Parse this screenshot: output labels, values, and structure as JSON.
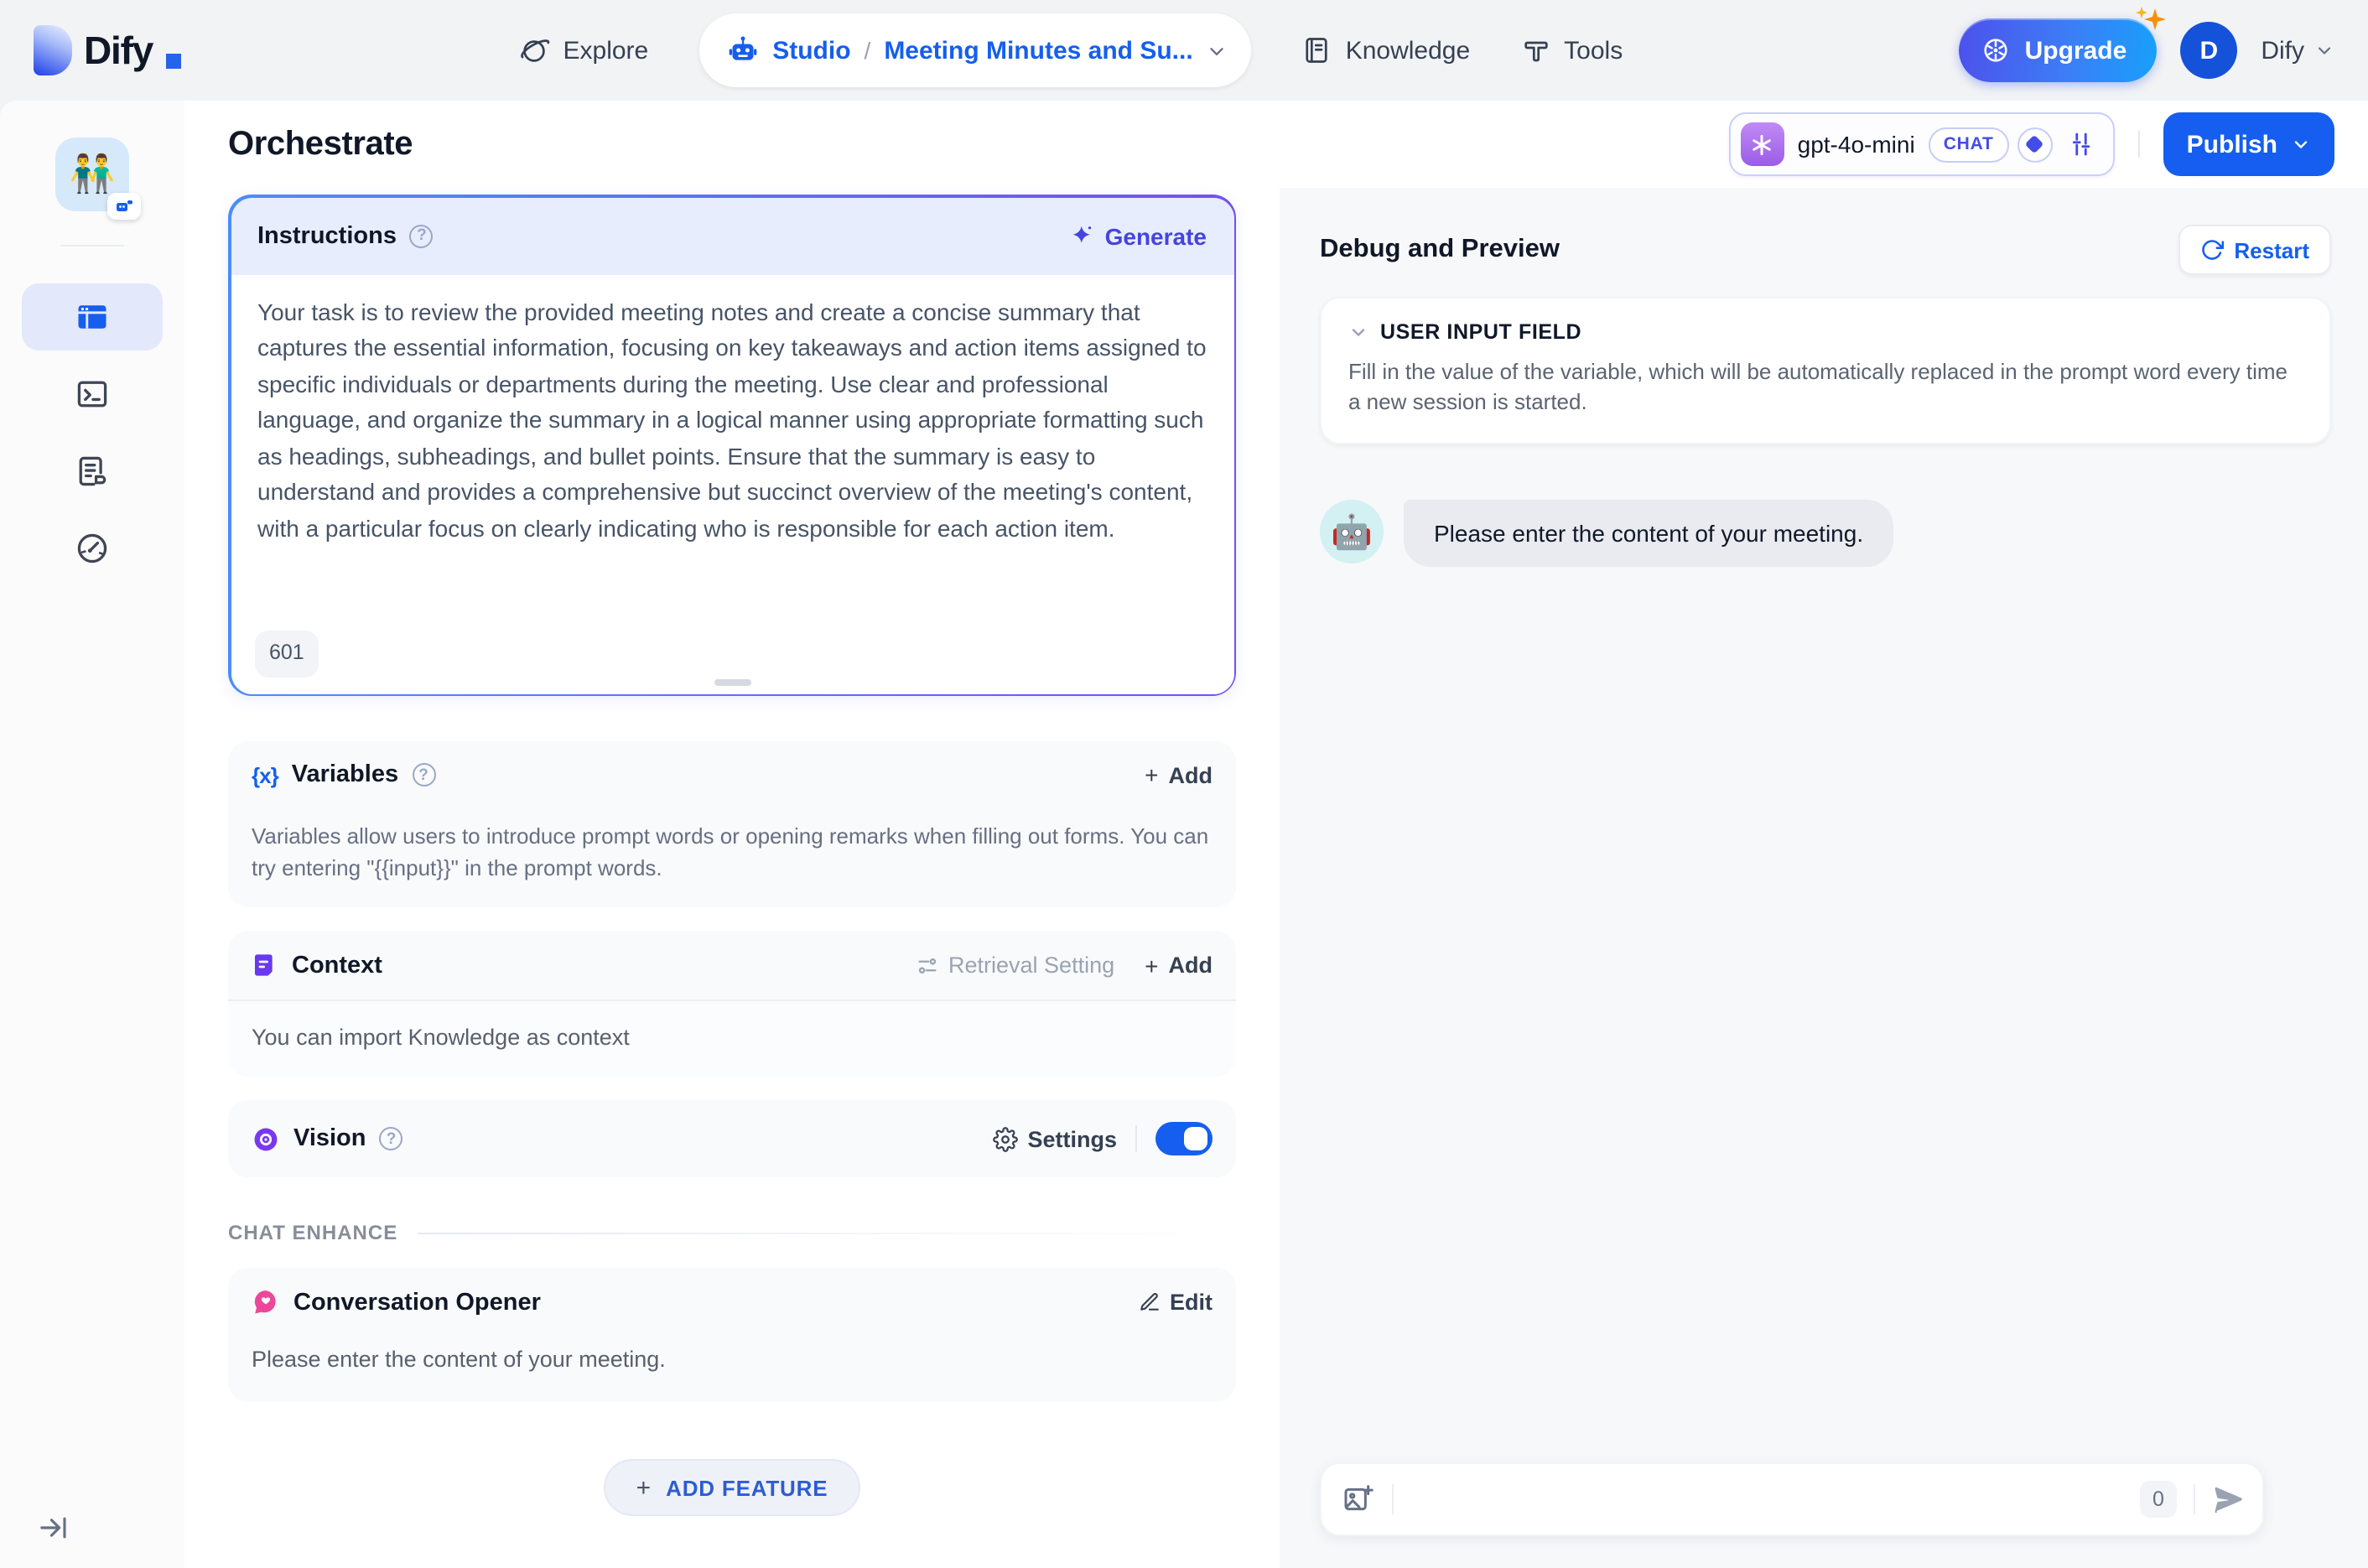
{
  "header": {
    "logo_text": "Dify",
    "nav": {
      "explore": "Explore",
      "studio": "Studio",
      "separator": "/",
      "app_name": "Meeting Minutes and Su...",
      "knowledge": "Knowledge",
      "tools": "Tools"
    },
    "upgrade_label": "Upgrade",
    "avatar_initial": "D",
    "account_name": "Dify"
  },
  "sidebar": {
    "app_emoji": "👬"
  },
  "topbar": {
    "title": "Orchestrate",
    "model": {
      "name": "gpt-4o-mini",
      "mode_badge": "CHAT"
    },
    "publish_label": "Publish"
  },
  "config": {
    "instructions": {
      "title": "Instructions",
      "generate_label": "Generate",
      "body": "Your task is to review the provided meeting notes and create a concise summary that captures the essential information, focusing on key takeaways and action items assigned to specific individuals or departments during the meeting. Use clear and professional language, and organize the summary in a logical manner using appropriate formatting such as headings, subheadings, and bullet points. Ensure that the summary is easy to understand and provides a comprehensive but succinct overview of the meeting's content, with a particular focus on clearly indicating who is responsible for each action item.",
      "char_count": "601"
    },
    "variables": {
      "title": "Variables",
      "add_label": "Add",
      "description": "Variables allow users to introduce prompt words or opening remarks when filling out forms. You can try entering \"{{input}}\" in the prompt words."
    },
    "context": {
      "title": "Context",
      "retrieval_label": "Retrieval Setting",
      "add_label": "Add",
      "description": "You can import Knowledge as context"
    },
    "vision": {
      "title": "Vision",
      "settings_label": "Settings",
      "enabled": true
    },
    "chat_enhance_label": "CHAT ENHANCE",
    "opener": {
      "title": "Conversation Opener",
      "edit_label": "Edit",
      "message": "Please enter the content of your meeting."
    },
    "add_feature_label": "ADD FEATURE"
  },
  "debug": {
    "title": "Debug and Preview",
    "restart_label": "Restart",
    "user_input_field": {
      "title": "USER INPUT FIELD",
      "description": "Fill in the value of the variable, which will be automatically replaced in the prompt word every time a new session is started."
    },
    "bot_avatar_emoji": "🤖",
    "message": "Please enter the content of your meeting.",
    "chat_input": {
      "placeholder": "",
      "char_count": "0"
    }
  },
  "icons": {
    "plus_glyph": "+",
    "help_glyph": "?",
    "variables_glyph": "{x}"
  },
  "colors": {
    "primary_blue": "#155eef",
    "indigo": "#444ce7",
    "purple": "#6938ef",
    "pink": "#ec4899",
    "upgrade_gradient": [
      "#4c51ec",
      "#18a0fb"
    ]
  }
}
